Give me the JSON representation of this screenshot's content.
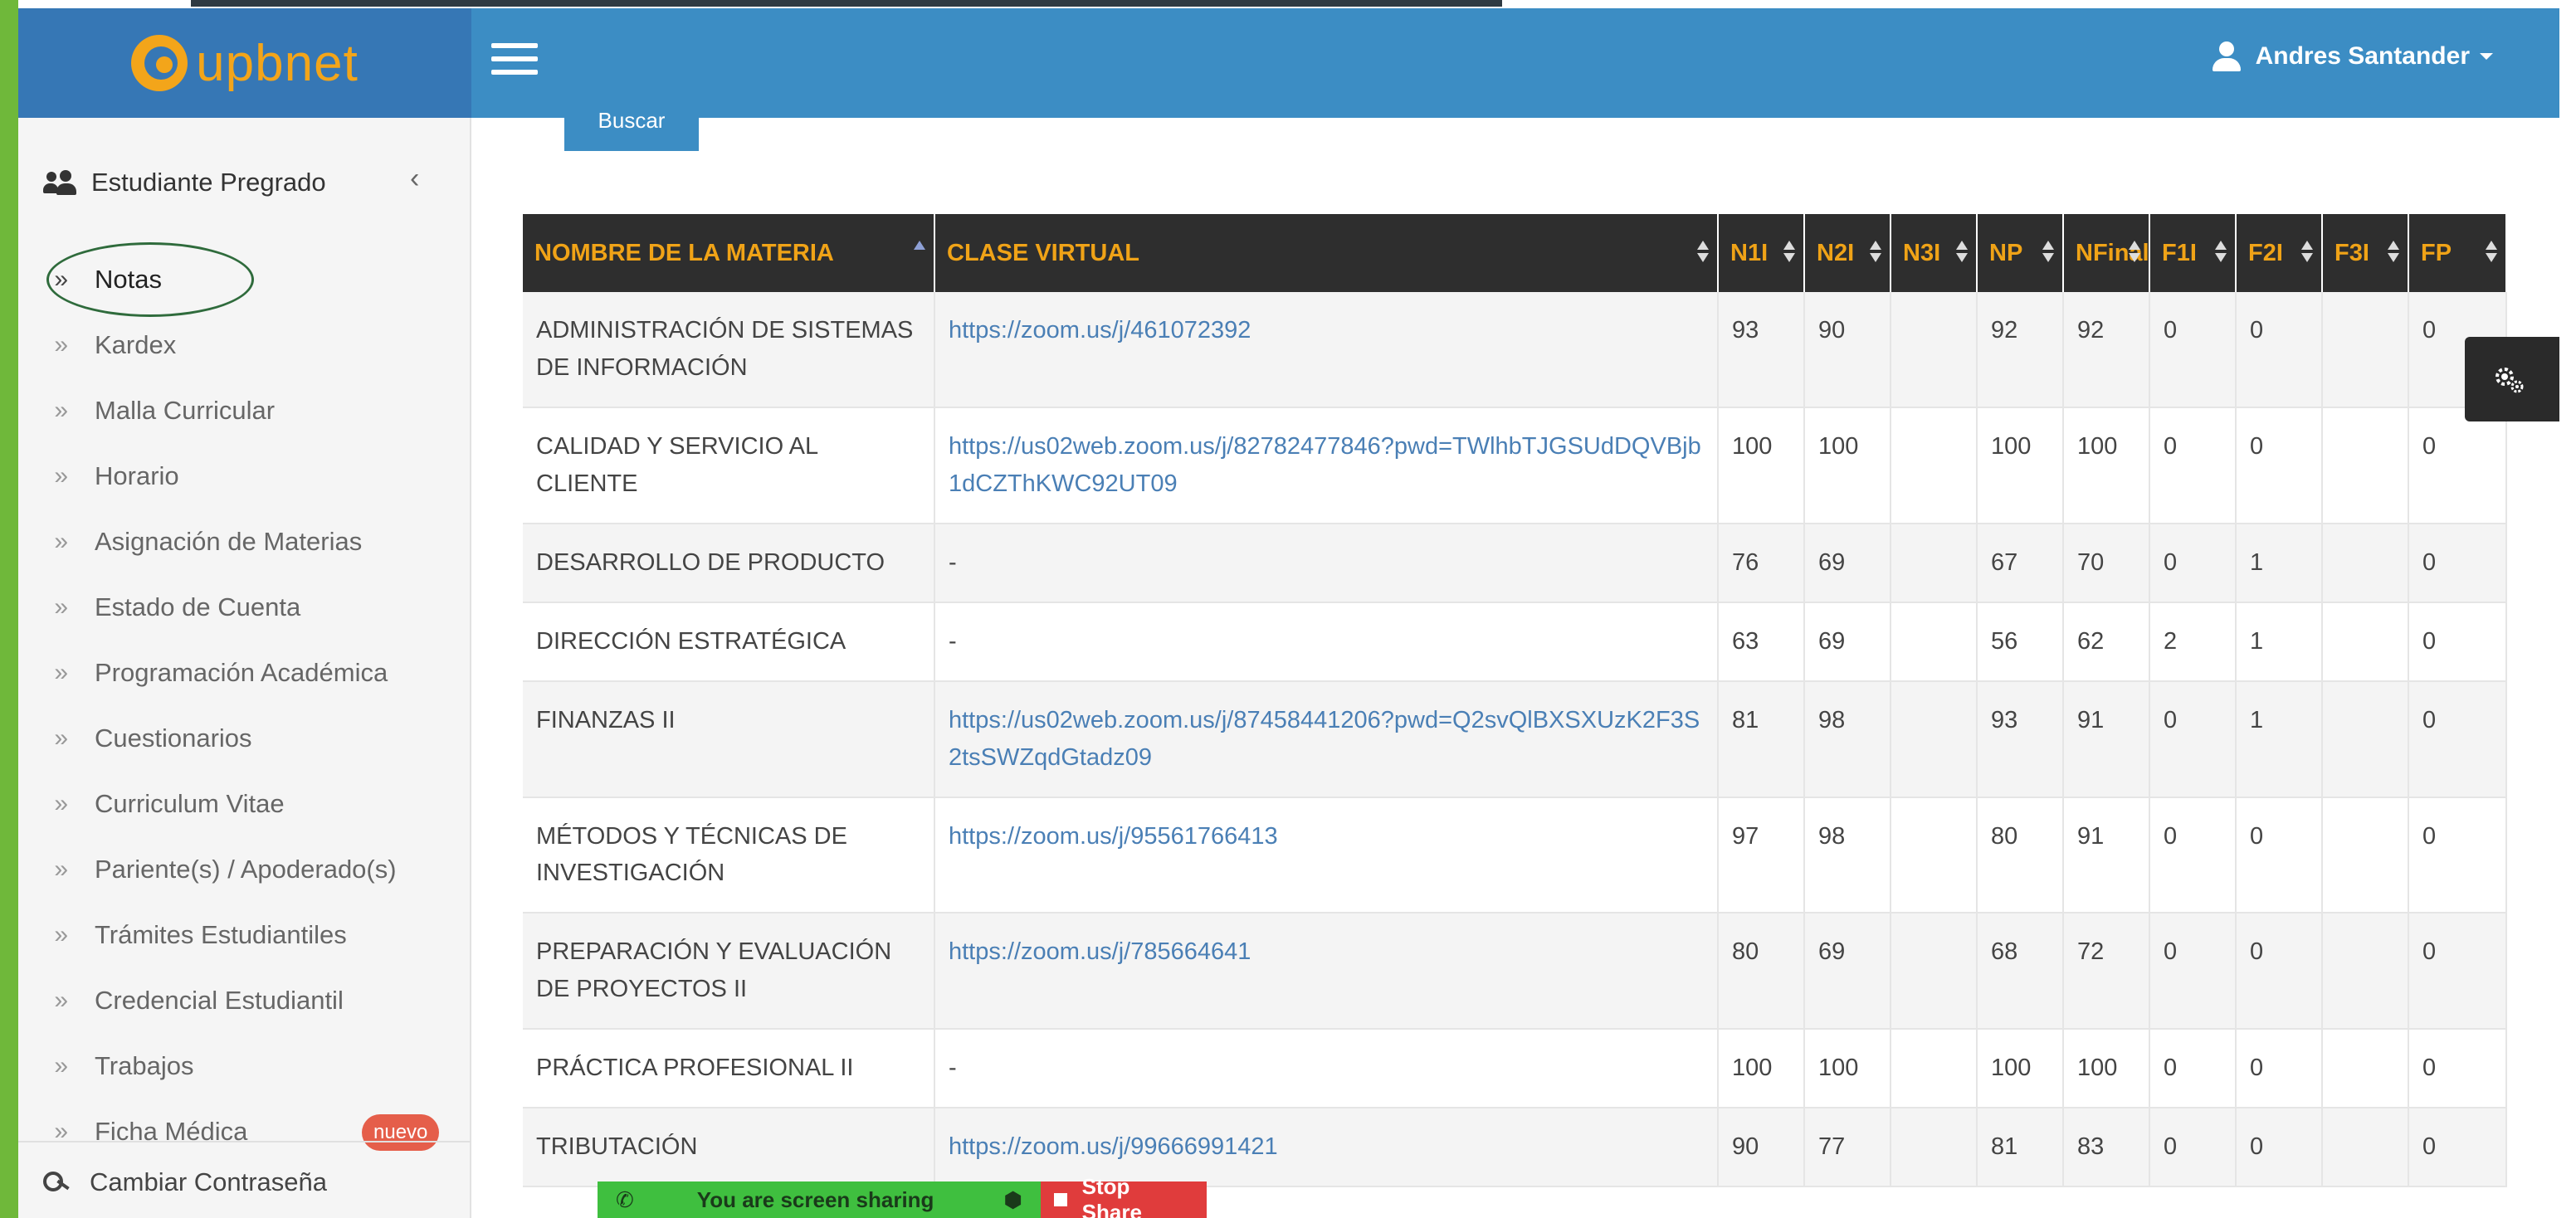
{
  "header": {
    "logo_text": "upbnet",
    "user_name": "Andres Santander"
  },
  "sidebar": {
    "section_title": "Estudiante Pregrado",
    "collapse_glyph": "‹",
    "bullet_glyph": "»",
    "items": [
      {
        "label": "Notas",
        "active": true
      },
      {
        "label": "Kardex"
      },
      {
        "label": "Malla Curricular"
      },
      {
        "label": "Horario"
      },
      {
        "label": "Asignación de Materias"
      },
      {
        "label": "Estado de Cuenta"
      },
      {
        "label": "Programación Académica"
      },
      {
        "label": "Cuestionarios"
      },
      {
        "label": "Curriculum Vitae"
      },
      {
        "label": "Pariente(s) / Apoderado(s)"
      },
      {
        "label": "Trámites Estudiantiles"
      },
      {
        "label": "Credencial Estudiantil"
      },
      {
        "label": "Trabajos"
      },
      {
        "label": "Ficha Médica",
        "badge": "nuevo"
      }
    ],
    "change_password": "Cambiar Contraseña"
  },
  "search_button": "Buscar",
  "table": {
    "headers": [
      "NOMBRE DE LA MATERIA",
      "CLASE VIRTUAL",
      "N1I",
      "N2I",
      "N3I",
      "NP",
      "NFinal",
      "F1I",
      "F2I",
      "F3I",
      "FP"
    ],
    "rows": [
      {
        "materia": "ADMINISTRACIÓN DE SISTEMAS DE INFORMACIÓN",
        "clase": "https://zoom.us/j/461072392",
        "n1": "93",
        "n2": "90",
        "n3": "",
        "np": "92",
        "nfinal": "92",
        "f1": "0",
        "f2": "0",
        "f3": "",
        "fp": "0"
      },
      {
        "materia": "CALIDAD Y SERVICIO AL CLIENTE",
        "clase": "https://us02web.zoom.us/j/82782477846?pwd=TWlhbTJGSUdDQVBjb1dCZThKWC92UT09",
        "n1": "100",
        "n2": "100",
        "n3": "",
        "np": "100",
        "nfinal": "100",
        "f1": "0",
        "f2": "0",
        "f3": "",
        "fp": "0"
      },
      {
        "materia": "DESARROLLO DE PRODUCTO",
        "clase": "-",
        "n1": "76",
        "n2": "69",
        "n3": "",
        "np": "67",
        "nfinal": "70",
        "f1": "0",
        "f2": "1",
        "f3": "",
        "fp": "0"
      },
      {
        "materia": "DIRECCIÓN ESTRATÉGICA",
        "clase": "-",
        "n1": "63",
        "n2": "69",
        "n3": "",
        "np": "56",
        "nfinal": "62",
        "f1": "2",
        "f2": "1",
        "f3": "",
        "fp": "0"
      },
      {
        "materia": "FINANZAS II",
        "clase": "https://us02web.zoom.us/j/87458441206?pwd=Q2svQlBXSXUzK2F3S2tsSWZqdGtadz09",
        "n1": "81",
        "n2": "98",
        "n3": "",
        "np": "93",
        "nfinal": "91",
        "f1": "0",
        "f2": "1",
        "f3": "",
        "fp": "0"
      },
      {
        "materia": "MÉTODOS Y TÉCNICAS DE INVESTIGACIÓN",
        "clase": "https://zoom.us/j/95561766413",
        "n1": "97",
        "n2": "98",
        "n3": "",
        "np": "80",
        "nfinal": "91",
        "f1": "0",
        "f2": "0",
        "f3": "",
        "fp": "0"
      },
      {
        "materia": "PREPARACIÓN Y EVALUACIÓN DE PROYECTOS II",
        "clase": "https://zoom.us/j/785664641",
        "n1": "80",
        "n2": "69",
        "n3": "",
        "np": "68",
        "nfinal": "72",
        "f1": "0",
        "f2": "0",
        "f3": "",
        "fp": "0"
      },
      {
        "materia": "PRÁCTICA PROFESIONAL II",
        "clase": "-",
        "n1": "100",
        "n2": "100",
        "n3": "",
        "np": "100",
        "nfinal": "100",
        "f1": "0",
        "f2": "0",
        "f3": "",
        "fp": "0"
      },
      {
        "materia": "TRIBUTACIÓN",
        "clase": "https://zoom.us/j/99666991421",
        "n1": "90",
        "n2": "77",
        "n3": "",
        "np": "81",
        "nfinal": "83",
        "f1": "0",
        "f2": "0",
        "f3": "",
        "fp": "0"
      }
    ]
  },
  "screen_share": {
    "status": "You are screen sharing",
    "stop": "Stop Share"
  },
  "colors": {
    "header_blue": "#3c8dc4",
    "logo_orange": "#f3a51a",
    "table_header_bg": "#2e2e2e",
    "table_header_text": "#f0a317",
    "link": "#4a7fb5",
    "badge": "#e55e4a"
  },
  "icons": [
    "hamburger-icon",
    "user-icon",
    "users-icon",
    "double-chevron-icon",
    "key-icon",
    "gear-icon",
    "sort-icon",
    "stop-icon",
    "phone-icon",
    "shield-icon"
  ]
}
